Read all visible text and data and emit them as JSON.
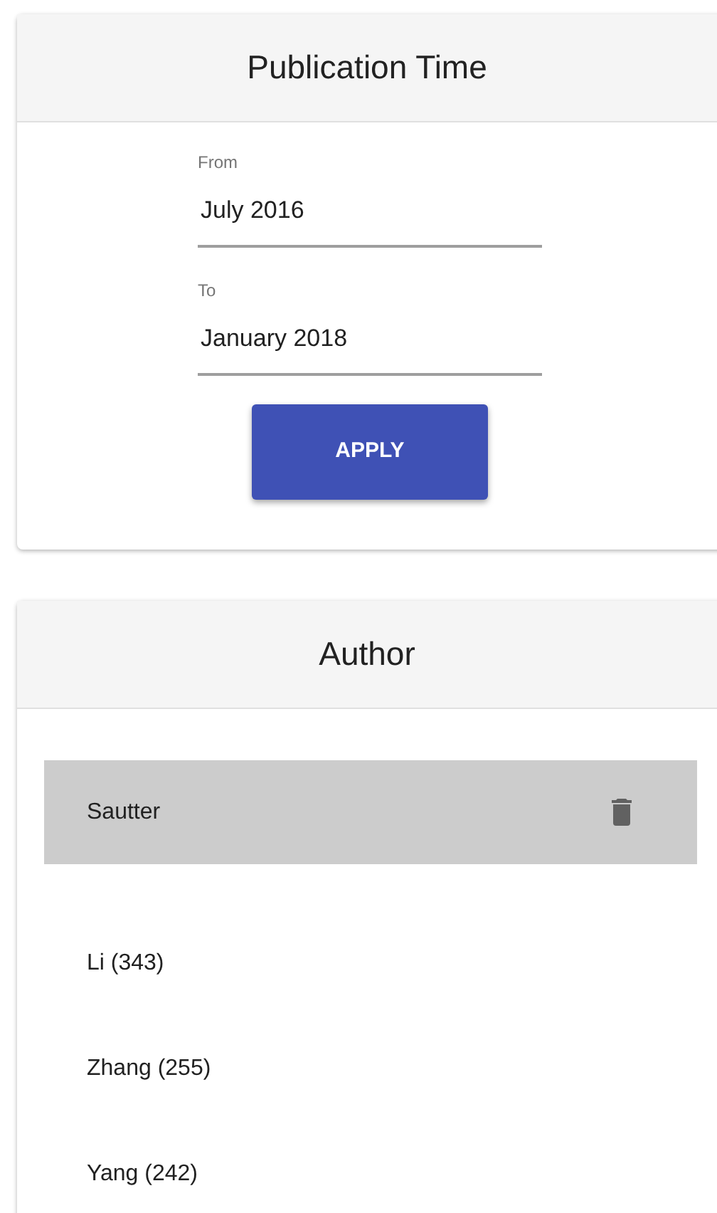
{
  "publication_time": {
    "title": "Publication Time",
    "fields": [
      {
        "label": "From",
        "value": "July 2016"
      },
      {
        "label": "To",
        "value": "January 2018"
      }
    ],
    "button": "APPLY"
  },
  "author": {
    "title": "Author",
    "items": [
      {
        "name": "Sautter",
        "selected": true
      },
      {
        "name": "Li (343)",
        "selected": false
      },
      {
        "name": "Zhang (255)",
        "selected": false
      },
      {
        "name": "Yang (242)",
        "selected": false
      }
    ]
  }
}
